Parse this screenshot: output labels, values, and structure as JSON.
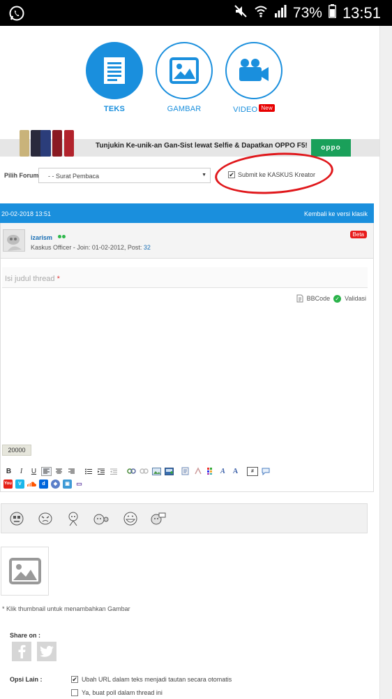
{
  "status_bar": {
    "battery": "73%",
    "time": "13:51"
  },
  "post_types": [
    {
      "label": "TEKS",
      "icon": "document-icon"
    },
    {
      "label": "GAMBAR",
      "icon": "image-icon"
    },
    {
      "label": "VIDEO",
      "icon": "video-camera-icon",
      "badge": "New"
    }
  ],
  "ad": {
    "text": "Tunjukin Ke-unik-an Gan-Sist lewat Selfie & Dapatkan OPPO F5!",
    "logo": "oppo"
  },
  "forum": {
    "label": "Pilih Forum",
    "selected": "- - Surat Pembaca"
  },
  "kreator": {
    "label": "Submit ke KASKUS Kreator",
    "checked": true
  },
  "header": {
    "date": "20-02-2018 13:51",
    "switch_link": "Kembali ke versi klasik"
  },
  "user": {
    "name": "izarism",
    "role_line": "Kaskus Officer - Join: 01-02-2012, Post: ",
    "posts": "32",
    "badge": "Beta"
  },
  "editor": {
    "title_placeholder": "Isi judul thread",
    "required_mark": "*",
    "bbcode_label": "BBCode",
    "validate_label": "Validasi",
    "char_counter": "20000"
  },
  "image_upload": {
    "note": "* Klik thumbnail untuk menambahkan Gambar"
  },
  "share": {
    "label": "Share on :"
  },
  "options": {
    "label": "Opsi Lain :",
    "items": [
      {
        "label": "Ubah URL dalam teks menjadi tautan secara otomatis",
        "checked": true
      },
      {
        "label": "Ya, buat poll dalam thread ini",
        "checked": false
      }
    ]
  },
  "colors": {
    "accent": "#1a8fdd",
    "annotation": "#e0181c",
    "badge": "#e81b1b",
    "online": "#2db84b"
  }
}
